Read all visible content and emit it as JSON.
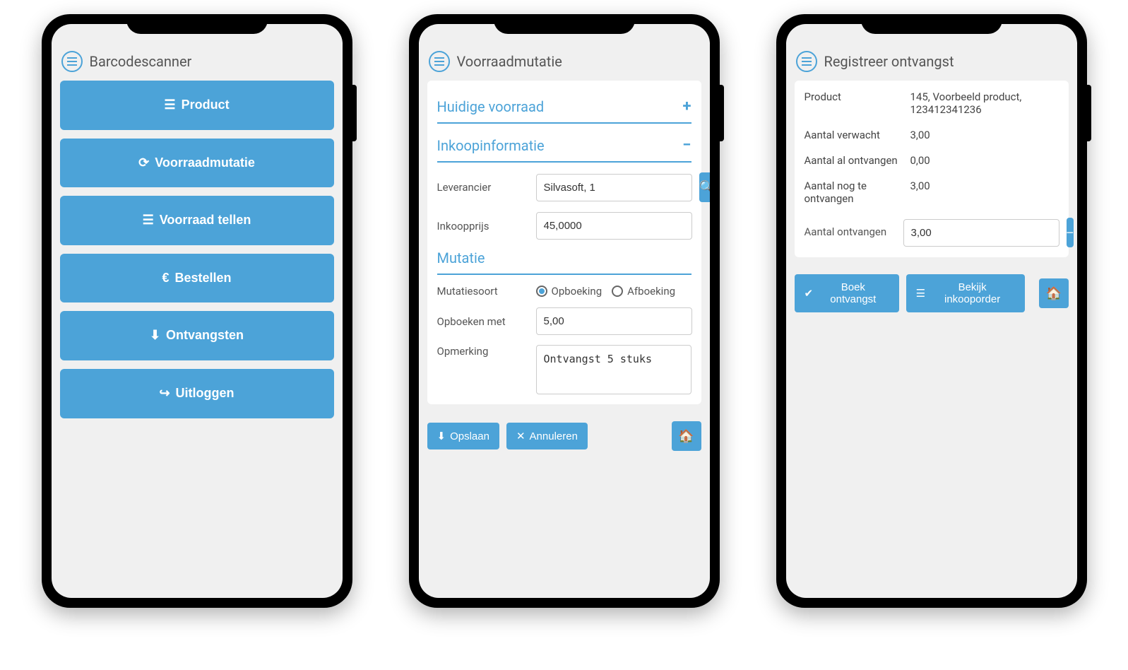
{
  "colors": {
    "accent": "#4ca3d8"
  },
  "phone1": {
    "title": "Barcodescanner",
    "menu": [
      {
        "icon": "list-icon",
        "label": "Product"
      },
      {
        "icon": "refresh-icon",
        "label": "Voorraadmutatie"
      },
      {
        "icon": "stack-icon",
        "label": "Voorraad tellen"
      },
      {
        "icon": "euro-icon",
        "label": "Bestellen"
      },
      {
        "icon": "download-icon",
        "label": "Ontvangsten"
      },
      {
        "icon": "logout-icon",
        "label": "Uitloggen"
      }
    ]
  },
  "phone2": {
    "title": "Voorraadmutatie",
    "section1": {
      "heading": "Huidige voorraad",
      "toggle": "+"
    },
    "section2": {
      "heading": "Inkoopinformatie",
      "toggle": "−"
    },
    "leverancier": {
      "label": "Leverancier",
      "value": "Silvasoft, 1"
    },
    "inkoopprijs": {
      "label": "Inkoopprijs",
      "value": "45,0000"
    },
    "mutatie_heading": "Mutatie",
    "mutatiesoort": {
      "label": "Mutatiesoort",
      "opt1": "Opboeking",
      "opt2": "Afboeking"
    },
    "opboeken": {
      "label": "Opboeken met",
      "value": "5,00"
    },
    "opmerking": {
      "label": "Opmerking",
      "value": "Ontvangst 5 stuks"
    },
    "buttons": {
      "save": "Opslaan",
      "cancel": "Annuleren"
    }
  },
  "phone3": {
    "title": "Registreer ontvangst",
    "rows": {
      "product": {
        "label": "Product",
        "value": "145, Voorbeeld product, 123412341236"
      },
      "verwacht": {
        "label": "Aantal verwacht",
        "value": "3,00"
      },
      "al_ontvangen": {
        "label": "Aantal al ontvangen",
        "value": "0,00"
      },
      "nog": {
        "label": "Aantal nog te ontvangen",
        "value": "3,00"
      },
      "ontvangen": {
        "label": "Aantal ontvangen",
        "value": "3,00"
      }
    },
    "buttons": {
      "boek": "Boek ontvangst",
      "bekijk": "Bekijk inkooporder"
    }
  }
}
